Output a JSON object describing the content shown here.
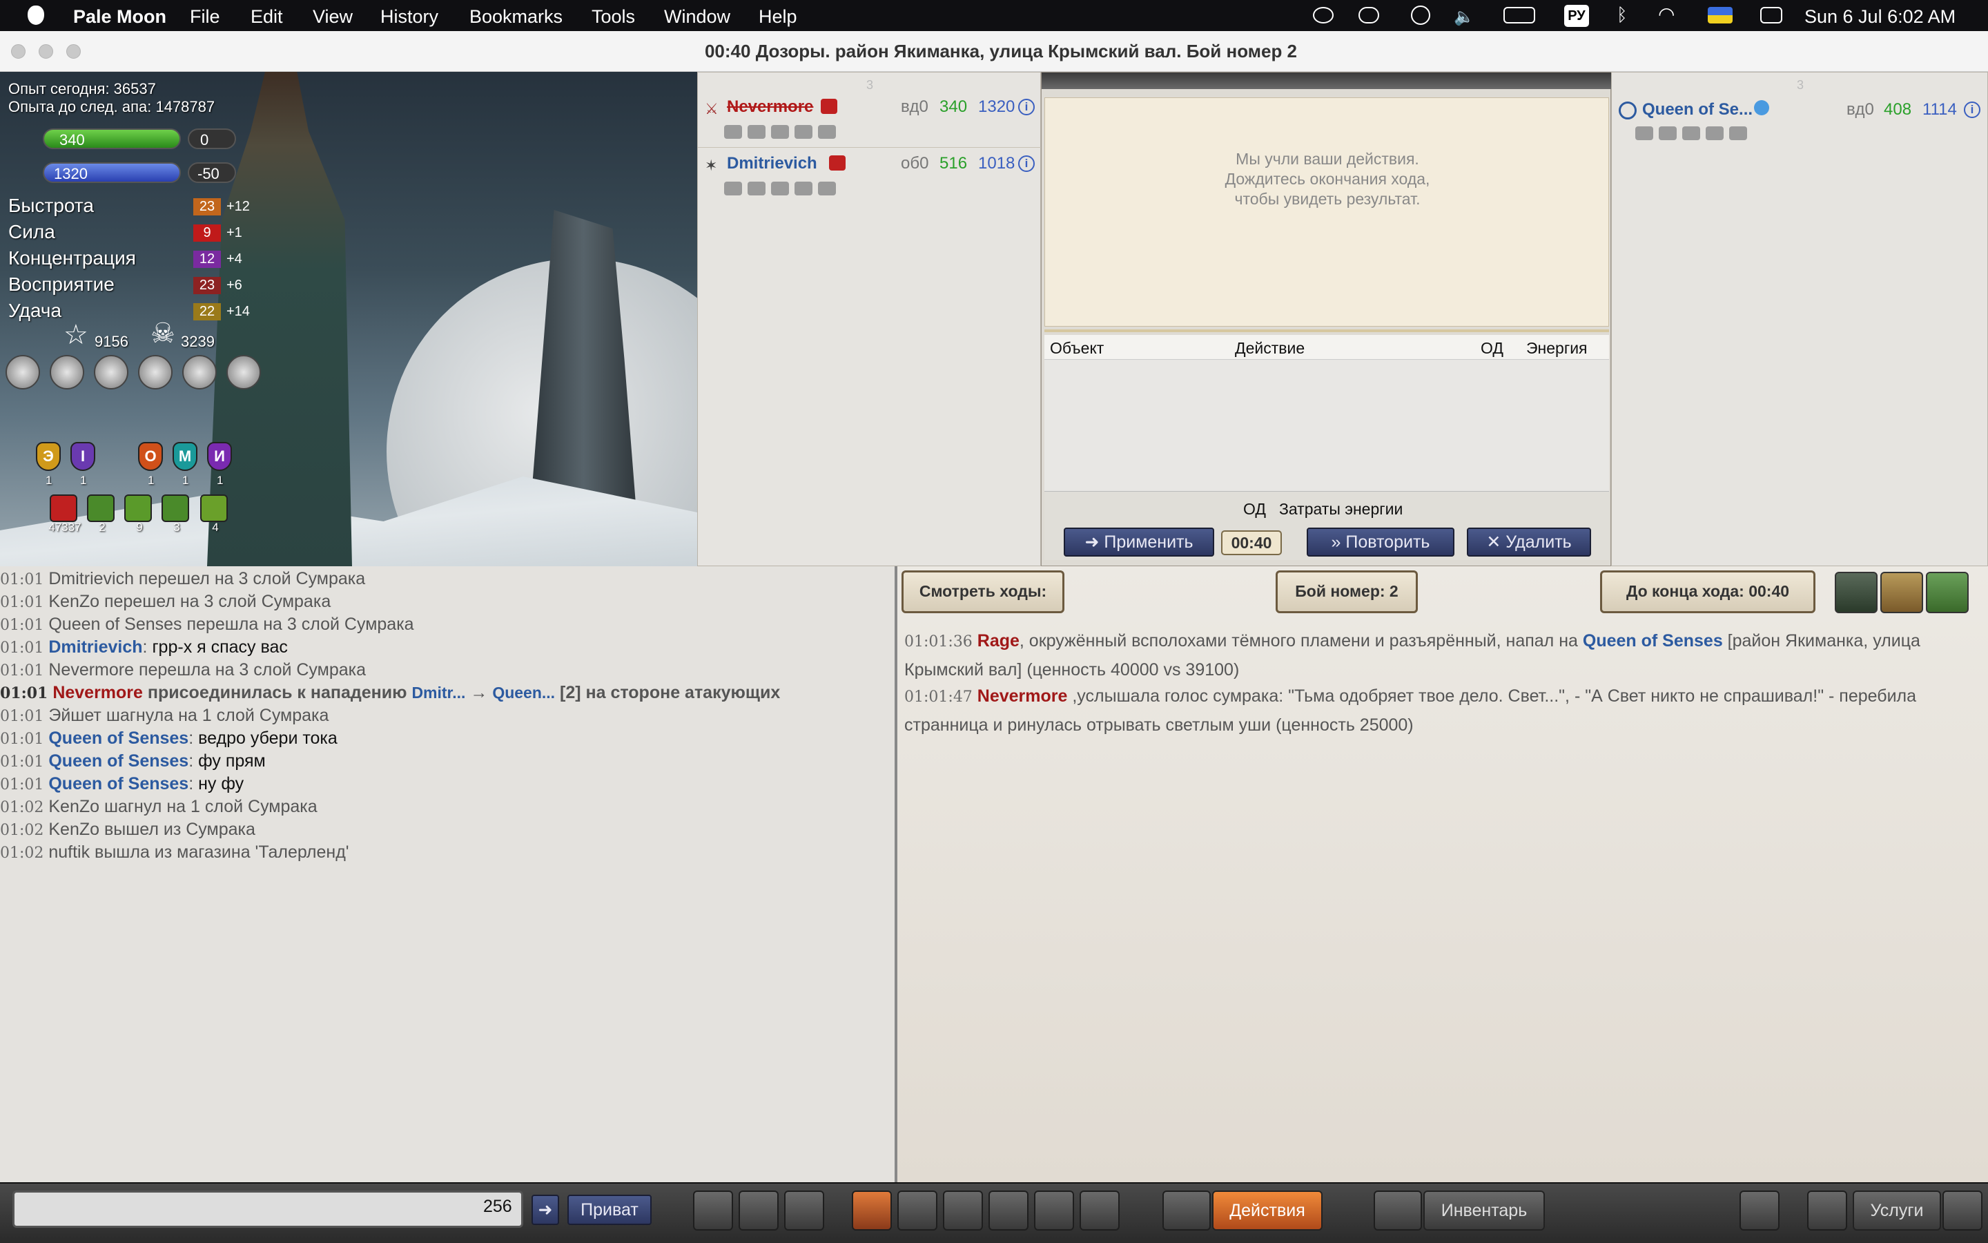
{
  "menubar": {
    "app": "Pale Moon",
    "items": [
      "File",
      "Edit",
      "View",
      "History",
      "Bookmarks",
      "Tools",
      "Window",
      "Help"
    ],
    "keyboard": "РУ",
    "datetime": "Sun 6 Jul  6:02 AM"
  },
  "window": {
    "title": "00:40 Дозоры. район Якиманка, улица Крымский вал. Бой номер 2"
  },
  "character": {
    "exp_today": "Опыт сегодня: 36537",
    "exp_next": "Опыта до след. апа: 1478787",
    "hp": "340",
    "hp_right": "0",
    "energy": "1320",
    "energy_right": "-50",
    "stats": [
      {
        "name": "Быстрота",
        "value": "23",
        "bonus": "+12",
        "color": "#c2661c"
      },
      {
        "name": "Сила",
        "value": "9",
        "bonus": "+1",
        "color": "#c01a1a"
      },
      {
        "name": "Концентрация",
        "value": "12",
        "bonus": "+4",
        "color": "#7a2aa0"
      },
      {
        "name": "Восприятие",
        "value": "23",
        "bonus": "+6",
        "color": "#8c2222"
      },
      {
        "name": "Удача",
        "value": "22",
        "bonus": "+14",
        "color": "#9a7a1a"
      }
    ],
    "star_count": "9156",
    "skull_count": "3239",
    "tool_icons": [
      "t-coin-icon",
      "wallet-icon",
      "jar-icon",
      "document-icon",
      "wrench-icon",
      "trophy-icon"
    ],
    "shields": [
      {
        "letter": "Э",
        "count": "1",
        "color": "#d09a1a"
      },
      {
        "letter": "I",
        "count": "1",
        "color": "#6a3ab0"
      },
      {
        "letter": "О",
        "count": "1",
        "color": "#d0501a"
      },
      {
        "letter": "М",
        "count": "1",
        "color": "#1a9a9a"
      },
      {
        "letter": "И",
        "count": "1",
        "color": "#7a2ab0"
      }
    ],
    "effects": [
      {
        "count": "47337",
        "color": "#c02020"
      },
      {
        "count": "2",
        "color": "#4a8a2a"
      },
      {
        "count": "9",
        "color": "#5a9a2a"
      },
      {
        "count": "3",
        "color": "#4a8a2a"
      },
      {
        "count": "4",
        "color": "#6aa02a"
      }
    ]
  },
  "team_left": {
    "number": "3",
    "fighters": [
      {
        "name": "Nevermore",
        "pos": "вд0",
        "hp": "340",
        "energy": "1320",
        "color": "#b01818",
        "strike": true
      },
      {
        "name": "Dmitrievich",
        "pos": "об0",
        "hp": "516",
        "energy": "1018",
        "color": "#2c5aa0",
        "strike": false
      }
    ]
  },
  "battle": {
    "notice": [
      "Мы учли ваши действия.",
      "Дождитесь окончания хода,",
      "чтобы увидеть результат."
    ],
    "columns": [
      "Объект",
      "Действие",
      "ОД",
      "Энергия"
    ],
    "summary_od": "ОД",
    "summary_energy": "Затраты энергии",
    "apply": "Применить",
    "timer": "00:40",
    "repeat": "Повторить",
    "delete": "Удалить"
  },
  "team_right": {
    "number": "3",
    "fighters": [
      {
        "name": "Queen of Se...",
        "pos": "вд0",
        "hp": "408",
        "energy": "1114"
      }
    ]
  },
  "chat": [
    {
      "time": "01:01",
      "text": "Dmitrievich перешел на 3 слой Сумрака"
    },
    {
      "time": "01:01",
      "text": "KenZo перешел на 3 слой Сумрака"
    },
    {
      "time": "01:01",
      "text": "Queen of Senses перешла на 3 слой Сумрака"
    },
    {
      "time": "01:01",
      "name": "Dmitrievich",
      "text": "грр-х я спасу вас"
    },
    {
      "time": "01:01",
      "text": "Nevermore перешла на 3 слой Сумрака"
    },
    {
      "time": "01:01",
      "special": true,
      "n1": "Nevermore",
      "t1": " присоединилась к нападению ",
      "n2": "Dmitr...",
      "arrow": " → ",
      "n3": "Queen...",
      "t2": " [2] на стороне атакующих"
    },
    {
      "time": "01:01",
      "text": "Эйшет шагнула на 1 слой Сумрака"
    },
    {
      "time": "01:01",
      "name": "Queen of Senses",
      "text": "ведро убери тока"
    },
    {
      "time": "01:01",
      "name": "Queen of Senses",
      "text": "фу прям"
    },
    {
      "time": "01:01",
      "name": "Queen of Senses",
      "text": "ну фу"
    },
    {
      "time": "01:02",
      "text": "KenZo шагнул на 1 слой Сумрака"
    },
    {
      "time": "01:02",
      "text": "KenZo вышел из Сумрака"
    },
    {
      "time": "01:02",
      "text": "nuftik вышла из магазина 'Талерленд'"
    }
  ],
  "log_header": {
    "view_moves": "Смотреть ходы:",
    "fight_no": "Бой номер: 2",
    "until_end": "До конца хода: 00:40"
  },
  "log": [
    {
      "time": "01:01:36",
      "name": "Rage",
      "text1": ", окружённый всполохами тёмного пламени и разъярённый, напал на ",
      "name2": "Queen of Senses",
      "text2": " [район Якиманка, улица Крымский вал] (ценность 40000 vs 39100)"
    },
    {
      "time": "01:01:47",
      "name": "Nevermore",
      "text1": " ,услышала голос сумрака: \"Тьма одобряет твое дело. Свет...\", - \"А Свет никто не спрашивал!\" - перебила странница и ринулась отрывать светлым уши (ценность 25000)"
    }
  ],
  "bottom": {
    "char_count": "256",
    "private": "Приват",
    "actions": "Действия",
    "inventory": "Инвентарь",
    "services": "Услуги"
  }
}
